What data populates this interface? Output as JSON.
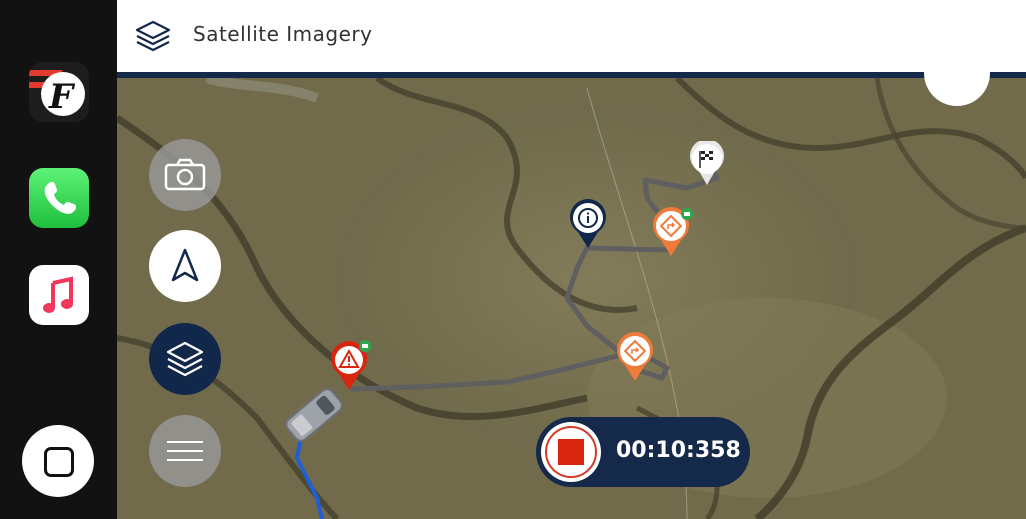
{
  "header": {
    "title": "Satellite Imagery",
    "icon": "layers-icon"
  },
  "dock": {
    "apps": [
      {
        "name": "ford-app",
        "icon": "ford-f-icon"
      },
      {
        "name": "phone",
        "icon": "phone-icon"
      },
      {
        "name": "music",
        "icon": "music-note-icon"
      }
    ],
    "home_icon": "home-square-icon"
  },
  "map_controls": [
    {
      "name": "camera",
      "icon": "camera-icon"
    },
    {
      "name": "navigate",
      "icon": "navigation-arrow-icon"
    },
    {
      "name": "layers",
      "icon": "layers-icon",
      "active": true
    },
    {
      "name": "menu",
      "icon": "menu-icon"
    }
  ],
  "recording": {
    "timer": "00:10:358",
    "stop_icon": "stop-icon"
  },
  "colors": {
    "navy": "#15294a",
    "orange_waypoint": "#f07a3a",
    "red_hazard": "#d8260f",
    "route_gray": "#5f5f60",
    "route_blue": "#1f5fd6"
  }
}
